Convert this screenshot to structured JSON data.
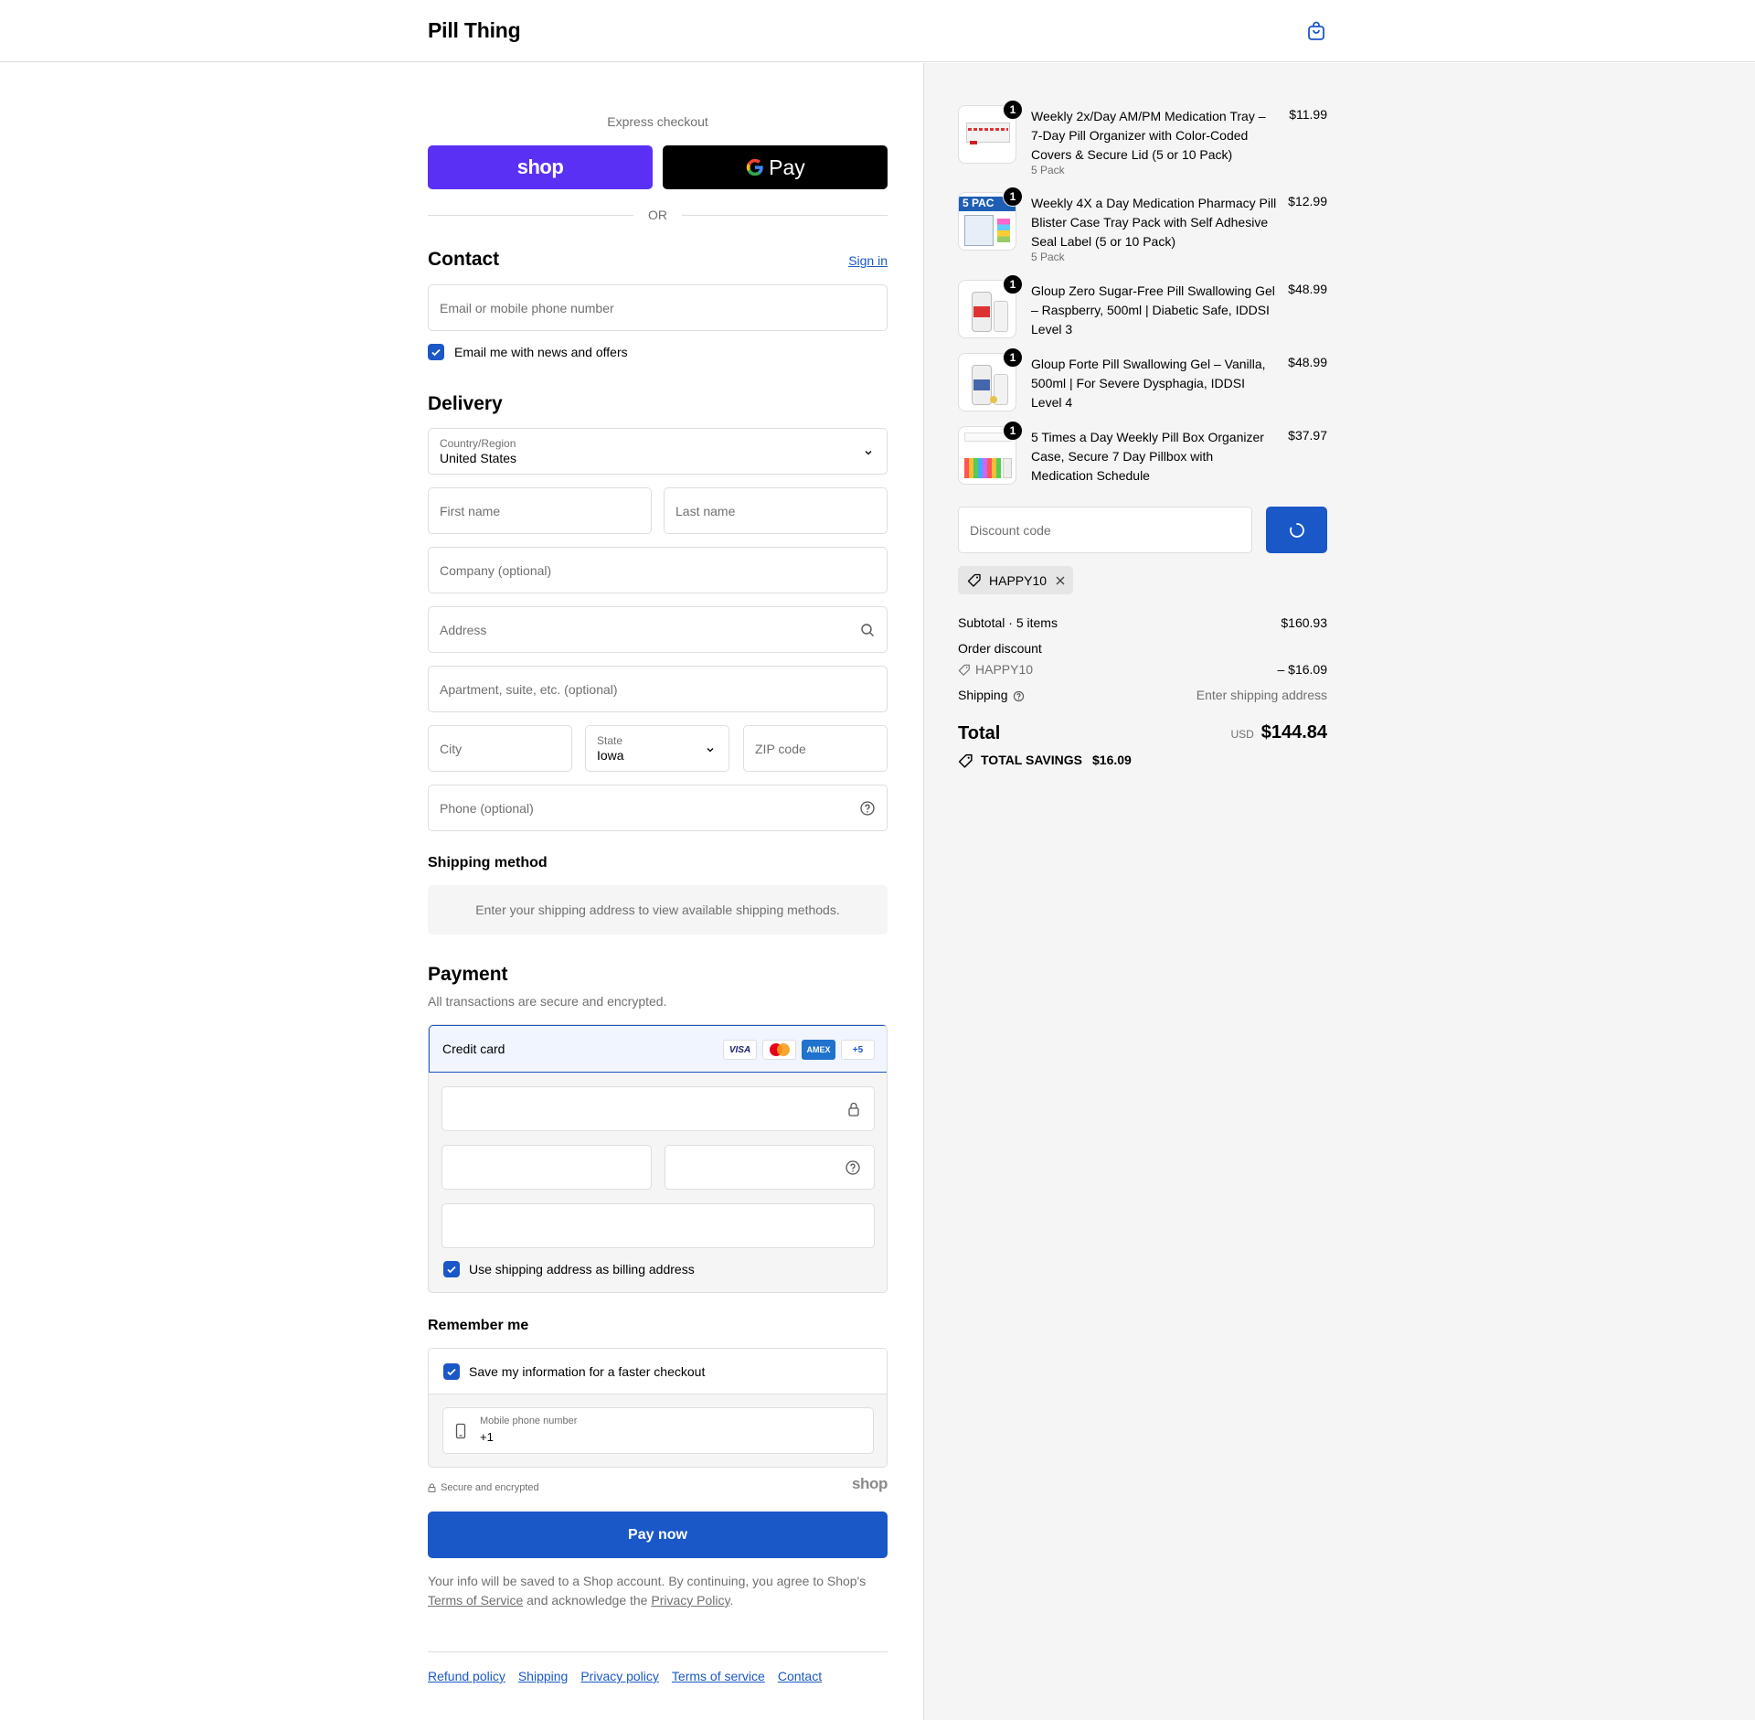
{
  "header": {
    "brand": "Pill Thing"
  },
  "express": {
    "title": "Express checkout",
    "shop_label": "shop",
    "gpay_label": "Pay",
    "or_label": "OR"
  },
  "contact": {
    "title": "Contact",
    "sign_in": "Sign in",
    "email_placeholder": "Email or mobile phone number",
    "newsletter_label": "Email me with news and offers",
    "newsletter_checked": true
  },
  "delivery": {
    "title": "Delivery",
    "country_label": "Country/Region",
    "country_value": "United States",
    "first_name": "First name",
    "last_name": "Last name",
    "company": "Company (optional)",
    "address": "Address",
    "apartment": "Apartment, suite, etc. (optional)",
    "city": "City",
    "state_label": "State",
    "state_value": "Iowa",
    "zip": "ZIP code",
    "phone": "Phone (optional)"
  },
  "shipping_method": {
    "title": "Shipping method",
    "message": "Enter your shipping address to view available shipping methods."
  },
  "payment": {
    "title": "Payment",
    "subtitle": "All transactions are secure and encrypted.",
    "method": "Credit card",
    "cards": [
      "VISA",
      "mastercard",
      "AMEX",
      "+5"
    ],
    "billing_label": "Use shipping address as billing address",
    "billing_checked": true
  },
  "remember": {
    "title": "Remember me",
    "save_label": "Save my information for a faster checkout",
    "phone_label": "Mobile phone number",
    "phone_value": "+1"
  },
  "secure_note": "Secure and encrypted",
  "shop_mark": "shop",
  "pay_now": "Pay now",
  "legal": {
    "prefix": "Your info will be saved to a Shop account. By continuing, you agree to Shop's",
    "tos": "Terms of Service",
    "middle": "and acknowledge the",
    "privacy": "Privacy Policy",
    "suffix": "."
  },
  "footer_links": [
    "Refund policy",
    "Shipping",
    "Privacy policy",
    "Terms of service",
    "Contact"
  ],
  "cart": {
    "items": [
      {
        "qty": "1",
        "title": "Weekly 2x/Day AM/PM Medication Tray – 7-Day Pill Organizer with Color-Coded Covers & Secure Lid (5 or 10 Pack)",
        "variant": "5 Pack",
        "price": "$11.99"
      },
      {
        "qty": "1",
        "title": "Weekly 4X a Day Medication Pharmacy Pill Blister Case Tray Pack with Self Adhesive Seal Label (5 or 10 Pack)",
        "variant": "5 Pack",
        "price": "$12.99"
      },
      {
        "qty": "1",
        "title": "Gloup Zero Sugar-Free Pill Swallowing Gel – Raspberry, 500ml | Diabetic Safe, IDDSI Level 3",
        "variant": "",
        "price": "$48.99"
      },
      {
        "qty": "1",
        "title": "Gloup Forte Pill Swallowing Gel – Vanilla, 500ml | For Severe Dysphagia, IDDSI Level 4",
        "variant": "",
        "price": "$48.99"
      },
      {
        "qty": "1",
        "title": "5 Times a Day Weekly Pill Box Organizer Case, Secure 7 Day Pillbox with Medication Schedule",
        "variant": "",
        "price": "$37.97"
      }
    ],
    "thumb_badge_text": "5 PAC",
    "discount_placeholder": "Discount code",
    "applied_code": "HAPPY10",
    "subtotal_label": "Subtotal · 5 items",
    "subtotal_value": "$160.93",
    "order_discount_label": "Order discount",
    "discount_code": "HAPPY10",
    "discount_value": "– $16.09",
    "shipping_label": "Shipping",
    "shipping_value": "Enter shipping address",
    "total_label": "Total",
    "currency": "USD",
    "total_value": "$144.84",
    "savings_label": "TOTAL SAVINGS",
    "savings_value": "$16.09"
  },
  "colors": {
    "accent": "#1a57c7",
    "shop_purple": "#5a31f4",
    "panel_bg": "#f5f5f5"
  }
}
